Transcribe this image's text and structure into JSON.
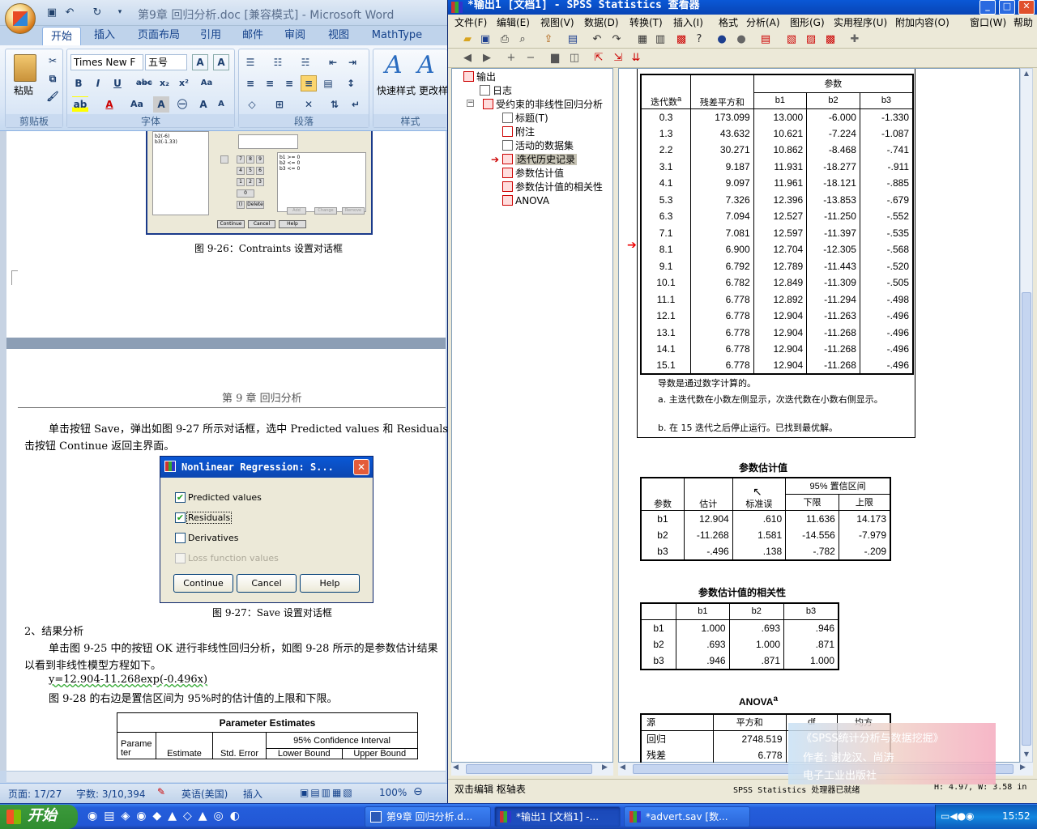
{
  "word": {
    "title": "第9章 回归分析.doc [兼容模式] - Microsoft Word",
    "tabs": [
      "开始",
      "插入",
      "页面布局",
      "引用",
      "邮件",
      "审阅",
      "视图",
      "MathType"
    ],
    "groups": {
      "clipboard": "剪贴板",
      "font": "字体",
      "paragraph": "段落",
      "styles": "样式"
    },
    "paste": "粘贴",
    "font_name": "Times New F",
    "font_size": "五号",
    "quick_style": "快速样式",
    "change_style": "更改样",
    "fig26_caption": "图 9-26：Contraints 设置对话框",
    "page_header": "第 9 章  回归分析",
    "para1_line1": "单击按钮 Save，弹出如图 9-27 所示对话框，选中 Predicted values 和 Residuals 选项",
    "para1_line2": "击按钮 Continue 返回主界面。",
    "fig27_caption": "图 9-27：Save 设置对话框",
    "section2": "2、结果分析",
    "para2_line1": "单击图 9-25 中的按钮 OK 进行非线性回归分析，如图 9-28 所示的是参数估计结果",
    "para2_line2": "以看到非线性模型方程如下。",
    "equation": "y=12.904-11.268exp(-0.496x)",
    "para3": "图 9-28 的右边是置信区间为 95%时的估计值的上限和下限。",
    "pe_table": {
      "title": "Parameter Estimates",
      "c0": "Parameter",
      "c1": "Estimate",
      "c2": "Std. Error",
      "ci": "95% Confidence Interval",
      "lb": "Lower Bound",
      "ub": "Upper Bound"
    },
    "status": {
      "page": "页面: 17/27",
      "words": "字数: 3/10,394",
      "lang": "英语(美国)",
      "insert": "插入",
      "zoom": "100%"
    },
    "embedded_fig": {
      "items": [
        "b2(-6)",
        "b3(-1.33)"
      ],
      "constraints": [
        "b1 >= 0",
        "b2 <= 0",
        "b3 <= 0"
      ],
      "buttons": [
        "Continue",
        "Cancel",
        "Help"
      ],
      "keys": [
        "7",
        "8",
        "9",
        "4",
        "5",
        "6",
        "1",
        "2",
        "3",
        "0",
        "()",
        "Delete"
      ],
      "sub_buttons": [
        "Add",
        "Change",
        "Remove"
      ]
    }
  },
  "dialog": {
    "title": "Nonlinear Regression: S...",
    "options": [
      {
        "label": "Predicted values",
        "checked": true,
        "enabled": true
      },
      {
        "label": "Residuals",
        "checked": true,
        "enabled": true
      },
      {
        "label": "Derivatives",
        "checked": false,
        "enabled": true
      },
      {
        "label": "Loss function values",
        "checked": false,
        "enabled": false
      }
    ],
    "buttons": [
      "Continue",
      "Cancel",
      "Help"
    ]
  },
  "spss": {
    "title": "*输出1 [文档1] - SPSS Statistics 查看器",
    "menu": [
      "文件(F)",
      "编辑(E)",
      "视图(V)",
      "数据(D)",
      "转换(T)",
      "插入(I)",
      "格式",
      "分析(A)",
      "图形(G)",
      "实用程序(U)",
      "附加内容(O)",
      "窗口(W)",
      "帮助"
    ],
    "tree": [
      "输出",
      "日志",
      "受约束的非线性回归分析",
      "标题(T)",
      "附注",
      "活动的数据集",
      "迭代历史记录",
      "参数估计值",
      "参数估计值的相关性",
      "ANOVA"
    ],
    "iter": {
      "headers": {
        "iter": "迭代数",
        "sup": "a",
        "rss": "残差平方和",
        "params": "参数",
        "b1": "b1",
        "b2": "b2",
        "b3": "b3"
      },
      "rows": [
        [
          "0.3",
          "173.099",
          "13.000",
          "-6.000",
          "-1.330"
        ],
        [
          "1.3",
          "43.632",
          "10.621",
          "-7.224",
          "-1.087"
        ],
        [
          "2.2",
          "30.271",
          "10.862",
          "-8.468",
          "-.741"
        ],
        [
          "3.1",
          "9.187",
          "11.931",
          "-18.277",
          "-.911"
        ],
        [
          "4.1",
          "9.097",
          "11.961",
          "-18.121",
          "-.885"
        ],
        [
          "5.3",
          "7.326",
          "12.396",
          "-13.853",
          "-.679"
        ],
        [
          "6.3",
          "7.094",
          "12.527",
          "-11.250",
          "-.552"
        ],
        [
          "7.1",
          "7.081",
          "12.597",
          "-11.397",
          "-.535"
        ],
        [
          "8.1",
          "6.900",
          "12.704",
          "-12.305",
          "-.568"
        ],
        [
          "9.1",
          "6.792",
          "12.789",
          "-11.443",
          "-.520"
        ],
        [
          "10.1",
          "6.782",
          "12.849",
          "-11.309",
          "-.505"
        ],
        [
          "11.1",
          "6.778",
          "12.892",
          "-11.294",
          "-.498"
        ],
        [
          "12.1",
          "6.778",
          "12.904",
          "-11.263",
          "-.496"
        ],
        [
          "13.1",
          "6.778",
          "12.904",
          "-11.268",
          "-.496"
        ],
        [
          "14.1",
          "6.778",
          "12.904",
          "-11.268",
          "-.496"
        ],
        [
          "15.1",
          "6.778",
          "12.904",
          "-11.268",
          "-.496"
        ]
      ],
      "note1": "导数是通过数字计算的。",
      "note2": "a. 主迭代数在小数左侧显示，次迭代数在小数右侧显示。",
      "note3": "b. 在 15 迭代之后停止运行。已找到最优解。"
    },
    "estimates": {
      "title": "参数估计值",
      "headers": {
        "param": "参数",
        "est": "估计",
        "se": "标准误",
        "ci": "95% 置信区间",
        "lo": "下限",
        "hi": "上限"
      },
      "rows": [
        [
          "b1",
          "12.904",
          ".610",
          "11.636",
          "14.173"
        ],
        [
          "b2",
          "-11.268",
          "1.581",
          "-14.556",
          "-7.979"
        ],
        [
          "b3",
          "-.496",
          ".138",
          "-.782",
          "-.209"
        ]
      ]
    },
    "corr": {
      "title": "参数估计值的相关性",
      "headers": [
        "",
        "b1",
        "b2",
        "b3"
      ],
      "rows": [
        [
          "b1",
          "1.000",
          ".693",
          ".946"
        ],
        [
          "b2",
          ".693",
          "1.000",
          ".871"
        ],
        [
          "b3",
          ".946",
          ".871",
          "1.000"
        ]
      ]
    },
    "anova": {
      "title": "ANOVA",
      "sup": "a",
      "headers": [
        "源",
        "平方和",
        "df",
        "均方"
      ],
      "rows": [
        [
          "回归",
          "2748.519"
        ],
        [
          "残差",
          "6.778"
        ]
      ]
    },
    "status": {
      "left": "双击编辑 枢轴表",
      "mid": "SPSS Statistics  处理器已就绪",
      "right": "H: 4.97, W: 3.58 in"
    }
  },
  "watermark": {
    "line1": "《SPSS统计分析与数据挖掘》",
    "line2": "作者:  谢龙汉、尚涛",
    "line3": "电子工业出版社"
  },
  "taskbar": {
    "start": "开始",
    "tasks": [
      "第9章 回归分析.d...",
      "*输出1 [文档1] -...",
      "*advert.sav [数..."
    ],
    "clock": "15:52"
  }
}
